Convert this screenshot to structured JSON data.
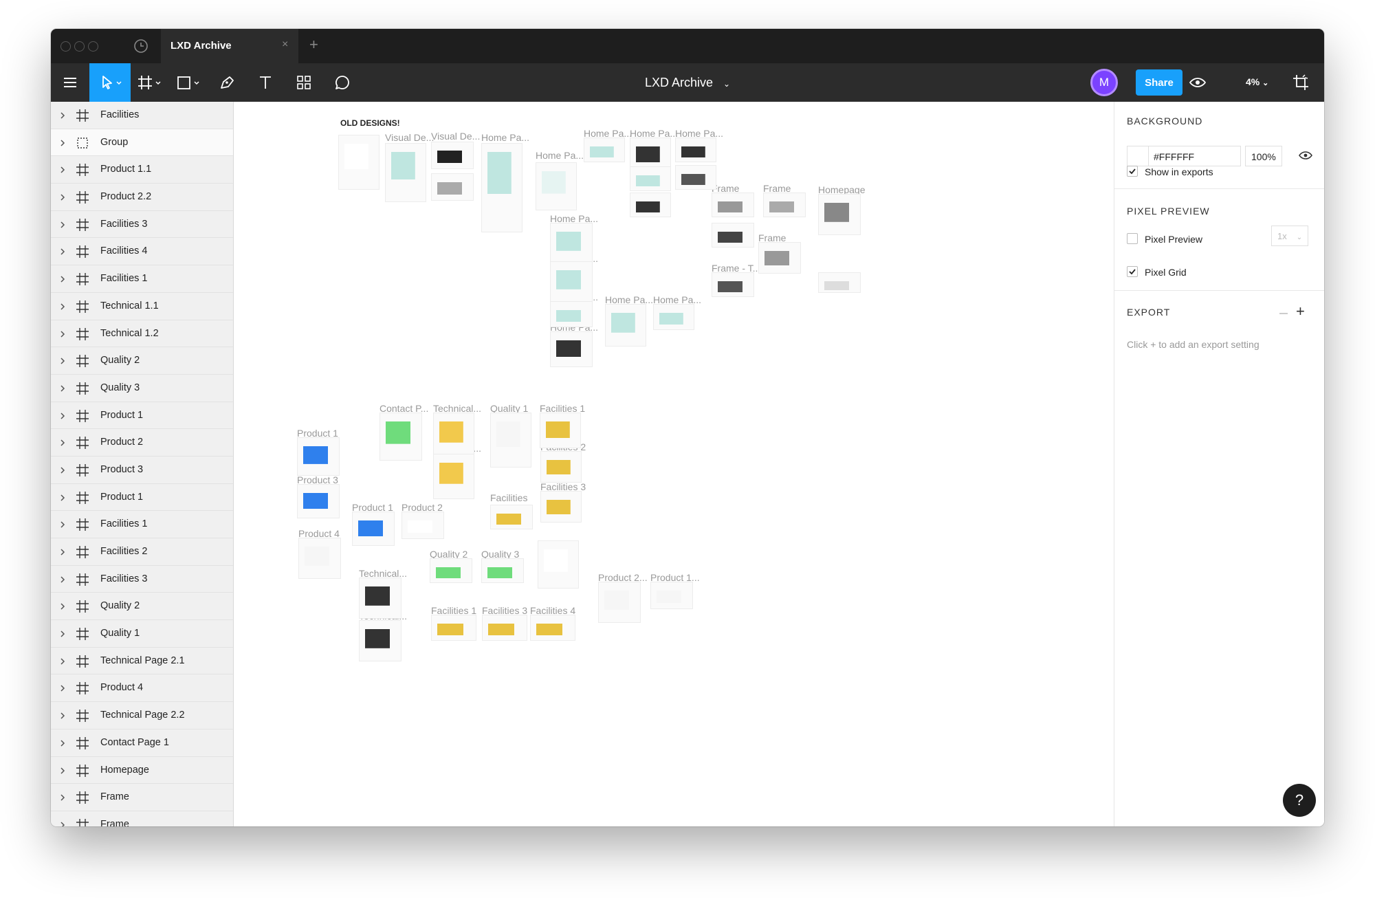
{
  "window": {
    "title": "LXD Archive"
  },
  "tab": {
    "title": "LXD Archive",
    "close": "×",
    "new": "+"
  },
  "toolbar": {
    "doc_title": "LXD Archive",
    "avatar_initial": "M",
    "share_label": "Share",
    "zoom": "4%",
    "accent": "#18a0fb"
  },
  "layers": [
    {
      "label": "Facilities",
      "icon": "frame-icon"
    },
    {
      "label": "Group",
      "icon": "group-icon",
      "selected": true
    },
    {
      "label": "Product 1.1",
      "icon": "frame-icon"
    },
    {
      "label": "Product 2.2",
      "icon": "frame-icon"
    },
    {
      "label": "Facilities 3",
      "icon": "frame-icon"
    },
    {
      "label": "Facilities 4",
      "icon": "frame-icon"
    },
    {
      "label": "Facilities 1",
      "icon": "frame-icon"
    },
    {
      "label": "Technical 1.1",
      "icon": "frame-icon"
    },
    {
      "label": "Technical 1.2",
      "icon": "frame-icon"
    },
    {
      "label": "Quality 2",
      "icon": "frame-icon"
    },
    {
      "label": "Quality 3",
      "icon": "frame-icon"
    },
    {
      "label": "Product 1",
      "icon": "frame-icon"
    },
    {
      "label": "Product 2",
      "icon": "frame-icon"
    },
    {
      "label": "Product 3",
      "icon": "frame-icon"
    },
    {
      "label": "Product 1",
      "icon": "frame-icon"
    },
    {
      "label": "Facilities 1",
      "icon": "frame-icon"
    },
    {
      "label": "Facilities 2",
      "icon": "frame-icon"
    },
    {
      "label": "Facilities 3",
      "icon": "frame-icon"
    },
    {
      "label": "Quality 2",
      "icon": "frame-icon"
    },
    {
      "label": "Quality 1",
      "icon": "frame-icon"
    },
    {
      "label": "Technical Page 2.1",
      "icon": "frame-icon"
    },
    {
      "label": "Product 4",
      "icon": "frame-icon"
    },
    {
      "label": "Technical Page 2.2",
      "icon": "frame-icon"
    },
    {
      "label": "Contact Page 1",
      "icon": "frame-icon"
    },
    {
      "label": "Homepage",
      "icon": "frame-icon"
    },
    {
      "label": "Frame",
      "icon": "frame-icon"
    },
    {
      "label": "Frame",
      "icon": "frame-icon"
    }
  ],
  "canvas": {
    "old_designs": "OLD DESIGNS!",
    "labels": [
      "Visual De...",
      "Visual De...",
      "Home Pa...",
      "Home Pa...",
      "Home Pa...",
      "Home Pa...",
      "Home Pa...",
      "Frame",
      "Frame",
      "Homepage",
      "Frame",
      "Frame - T...",
      "Home Pa...",
      "Home Pa...",
      "Home Pa...",
      "Home Pa...",
      "Home Pa...",
      "Home Pa...",
      "Contact P...",
      "Technical...",
      "Quality 1",
      "Facilities 1",
      "Product 1",
      "Quality 2",
      "Technical...",
      "Facilities 2",
      "Product 3",
      "Facilities 3",
      "Facilities",
      "Product 1",
      "Product 2",
      "Product 4",
      "Quality 2",
      "Quality 3",
      "Technical...",
      "Product 2...",
      "Product 1...",
      "Technical...",
      "Facilities 1",
      "Facilities 3",
      "Facilities 4"
    ]
  },
  "properties": {
    "background": {
      "title": "BACKGROUND",
      "hex": "#FFFFFF",
      "opacity": "100%",
      "show_in_exports": "Show in exports"
    },
    "pixel_preview": {
      "title": "PIXEL PREVIEW",
      "preview_label": "Pixel Preview",
      "preview_scale": "1x",
      "grid_label": "Pixel Grid"
    },
    "export": {
      "title": "EXPORT",
      "hint": "Click + to add an export setting"
    }
  },
  "help": {
    "label": "?"
  }
}
